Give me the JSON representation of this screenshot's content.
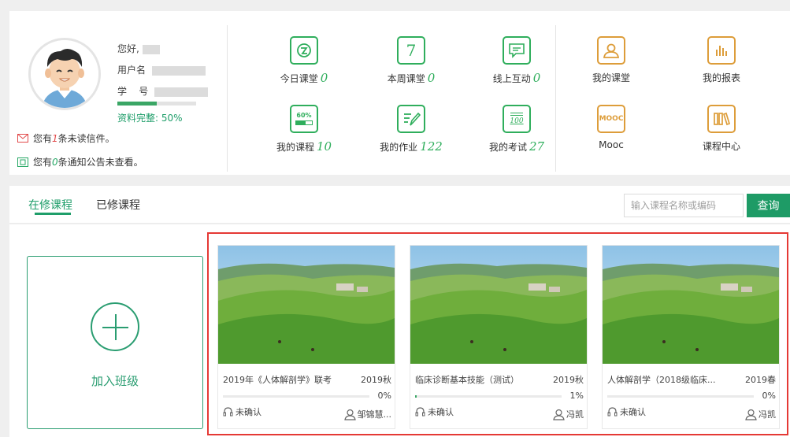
{
  "profile": {
    "greeting": "您好,",
    "username_label": "用户名",
    "student_id_label": "学    号",
    "completion_label": "资料完整:",
    "completion_value": "50%",
    "completion_fraction": 0.5,
    "notices": {
      "mail_prefix": "您有",
      "mail_count": "1",
      "mail_suffix": "条未读信件。",
      "announce_prefix": "您有",
      "announce_count": "0",
      "announce_suffix": "条通知公告未查看。"
    }
  },
  "stats": [
    {
      "label": "今日课堂",
      "count": "0",
      "icon": "today-class-icon"
    },
    {
      "label": "本周课堂",
      "count": "0",
      "icon": "calendar-icon"
    },
    {
      "label": "线上互动",
      "count": "0",
      "icon": "chat-icon"
    },
    {
      "label": "我的课程",
      "count": "10",
      "icon": "course-progress-icon"
    },
    {
      "label": "我的作业",
      "count": "122",
      "icon": "homework-icon"
    },
    {
      "label": "我的考试",
      "count": "27",
      "icon": "exam-icon"
    }
  ],
  "shortcuts": [
    {
      "label": "我的课堂",
      "icon": "classroom-icon"
    },
    {
      "label": "我的报表",
      "icon": "report-icon"
    },
    {
      "label": "Mooc",
      "icon": "mooc-icon",
      "icon_text": "MOOC"
    },
    {
      "label": "课程中心",
      "icon": "course-center-icon"
    }
  ],
  "icon_glyphs": {
    "calendar_day": "7",
    "progress_pct": "60%",
    "exam_score": "100"
  },
  "tabs": [
    "在修课程",
    "已修课程"
  ],
  "search": {
    "placeholder": "输入课程名称或编码",
    "button": "查询"
  },
  "join": {
    "label": "加入班级"
  },
  "courses": [
    {
      "title": "2019年《人体解剖学》联考",
      "semester": "2019秋",
      "progress": "0%",
      "progress_fraction": 0.0,
      "status": "未确认",
      "teacher": "邹锦慧..."
    },
    {
      "title": "临床诊断基本技能（测试）",
      "semester": "2019秋",
      "progress": "1%",
      "progress_fraction": 0.01,
      "status": "未确认",
      "teacher": "冯凯"
    },
    {
      "title": "人体解剖学（2018级临床...",
      "semester": "2019春",
      "progress": "0%",
      "progress_fraction": 0.0,
      "status": "未确认",
      "teacher": "冯凯"
    }
  ],
  "colors": {
    "accent": "#1f9e6a",
    "icon_green": "#2fae5c",
    "icon_orange": "#dd9d3a",
    "highlight": "#e53935"
  }
}
